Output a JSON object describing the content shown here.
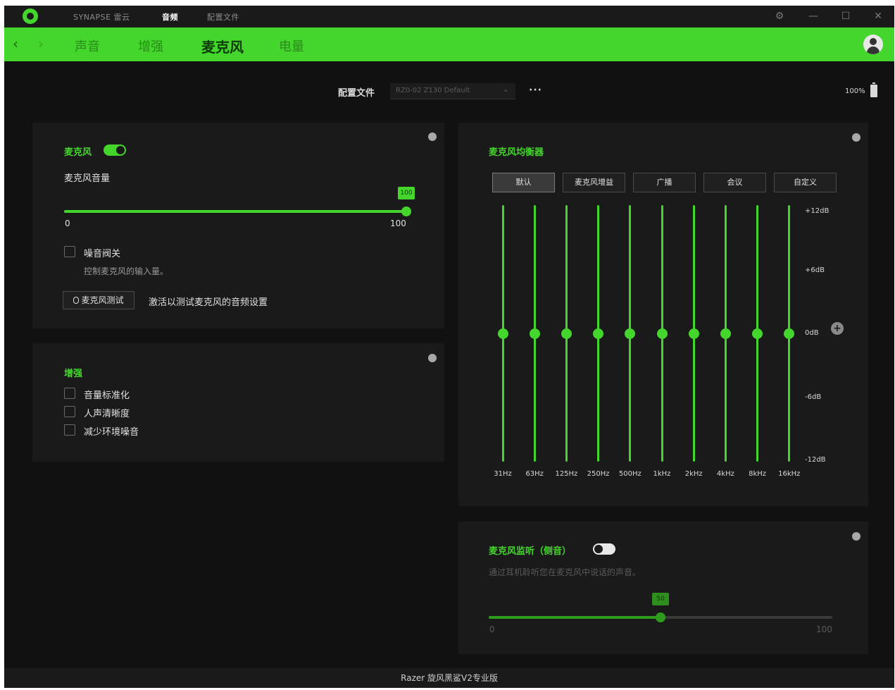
{
  "titlebar": {
    "tabs": [
      "SYNAPSE 雷云",
      "音频",
      "配置文件"
    ],
    "active_tab": 1,
    "controls": [
      "settings-icon",
      "minimize-icon",
      "maximize-icon",
      "close-icon"
    ]
  },
  "nav": {
    "back": "‹",
    "forward": "›",
    "tabs": [
      "声音",
      "增强",
      "麦克风",
      "电量"
    ],
    "active_tab": 2
  },
  "profile": {
    "label": "配置文件",
    "value": "RZ0-02 Z130 Default",
    "more": "···"
  },
  "battery": {
    "text": "100%"
  },
  "mic_panel": {
    "toggle_label": "麦克风",
    "toggle_on": true,
    "volume_label": "麦克风音量",
    "volume_value": "100",
    "min": "0",
    "max": "100",
    "volume_fraction": 1.0,
    "noise_gate_label": "噪音阀关",
    "noise_gate_desc": "控制麦克风的输入量。",
    "test_button": "麦克风测试",
    "test_desc": "激活以测试麦克风的音频设置"
  },
  "enhance_panel": {
    "title": "增强",
    "options": [
      "音量标准化",
      "人声清晰度",
      "减少环境噪音"
    ]
  },
  "eq_panel": {
    "title": "麦克风均衡器",
    "presets": [
      "默认",
      "麦克风增益",
      "广播",
      "会议",
      "自定义"
    ],
    "active_preset": 0,
    "db_labels": [
      "+12dB",
      "+6dB",
      "0dB",
      "-6dB",
      "-12dB"
    ],
    "frequencies": [
      "31Hz",
      "63Hz",
      "125Hz",
      "250Hz",
      "500Hz",
      "1kHz",
      "2kHz",
      "4kHz",
      "8kHz",
      "16kHz"
    ],
    "values_db": [
      0,
      0,
      0,
      0,
      0,
      0,
      0,
      0,
      0,
      0
    ],
    "add_button": "+"
  },
  "monitor_panel": {
    "title": "麦克风监听（侧音）",
    "toggle_on": false,
    "desc": "通过耳机聆听您在麦克风中说话的声音。",
    "value": "50",
    "min": "0",
    "max": "100",
    "fraction": 0.5
  },
  "footer": {
    "text": "Razer 旋风黑鲨V2专业版"
  },
  "colors": {
    "accent": "#44d62c",
    "background": "#111111",
    "panel": "#1a1a1a"
  }
}
